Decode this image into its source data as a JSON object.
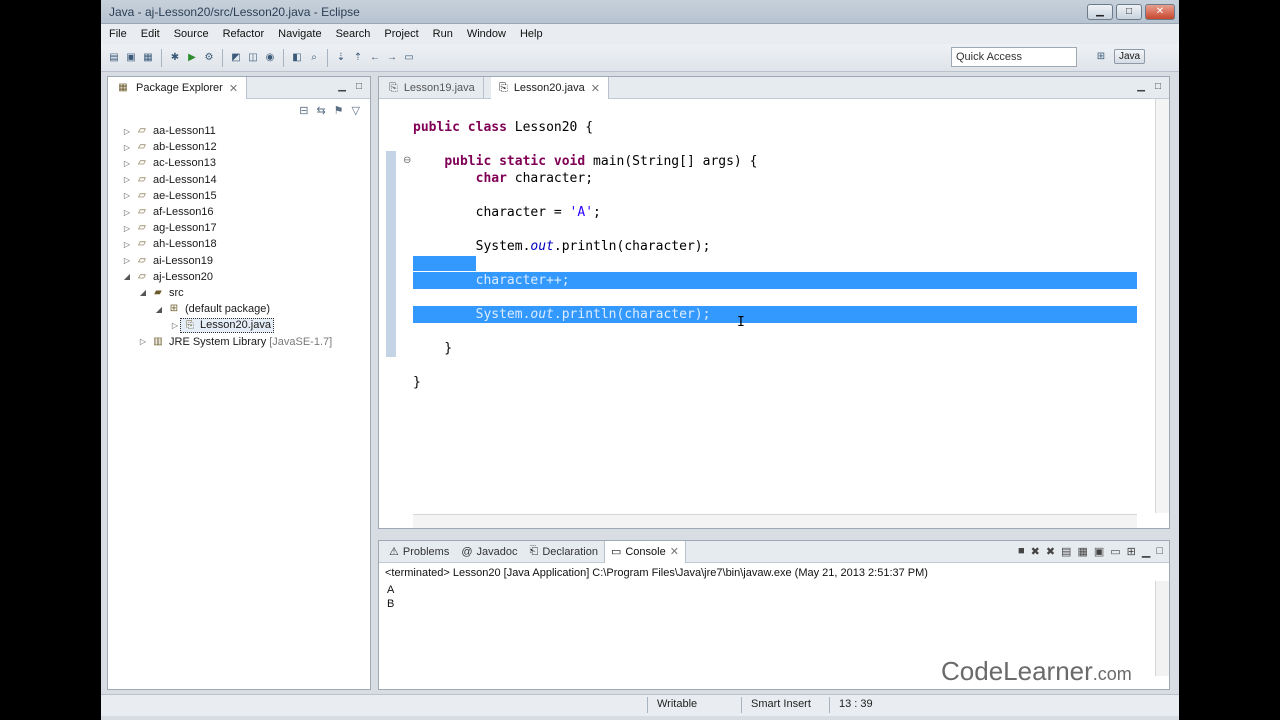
{
  "window": {
    "title": "Java - aj-Lesson20/src/Lesson20.java - Eclipse",
    "minimize": "▁",
    "maximize": "□",
    "close": "✕"
  },
  "menu": [
    "File",
    "Edit",
    "Source",
    "Refactor",
    "Navigate",
    "Search",
    "Project",
    "Run",
    "Window",
    "Help"
  ],
  "toolbar": {
    "quick_access": "Quick Access",
    "perspective": "Java"
  },
  "package_explorer": {
    "title": "Package Explorer",
    "projects": [
      {
        "name": "aa-Lesson11",
        "expanded": false
      },
      {
        "name": "ab-Lesson12",
        "expanded": false
      },
      {
        "name": "ac-Lesson13",
        "expanded": false
      },
      {
        "name": "ad-Lesson14",
        "expanded": false
      },
      {
        "name": "ae-Lesson15",
        "expanded": false
      },
      {
        "name": "af-Lesson16",
        "expanded": false
      },
      {
        "name": "ag-Lesson17",
        "expanded": false
      },
      {
        "name": "ah-Lesson18",
        "expanded": false
      },
      {
        "name": "ai-Lesson19",
        "expanded": false
      },
      {
        "name": "aj-Lesson20",
        "expanded": true
      }
    ],
    "src": "src",
    "default_package": "(default package)",
    "selected_file": "Lesson20.java",
    "jre": "JRE System Library",
    "jre_version": "[JavaSE-1.7]"
  },
  "editor": {
    "tabs": [
      {
        "label": "Lesson19.java",
        "active": false
      },
      {
        "label": "Lesson20.java",
        "active": true
      }
    ]
  },
  "console": {
    "tabs": [
      "Problems",
      "Javadoc",
      "Declaration",
      "Console"
    ],
    "status": "<terminated> Lesson20 [Java Application] C:\\Program Files\\Java\\jre7\\bin\\javaw.exe (May 21, 2013 2:51:37 PM)",
    "output": [
      "A",
      "B"
    ]
  },
  "statusbar": {
    "writable": "Writable",
    "insert_mode": "Smart Insert",
    "position": "13 : 39"
  },
  "watermark": {
    "brand": "CodeLearner",
    "tld": ".com"
  }
}
